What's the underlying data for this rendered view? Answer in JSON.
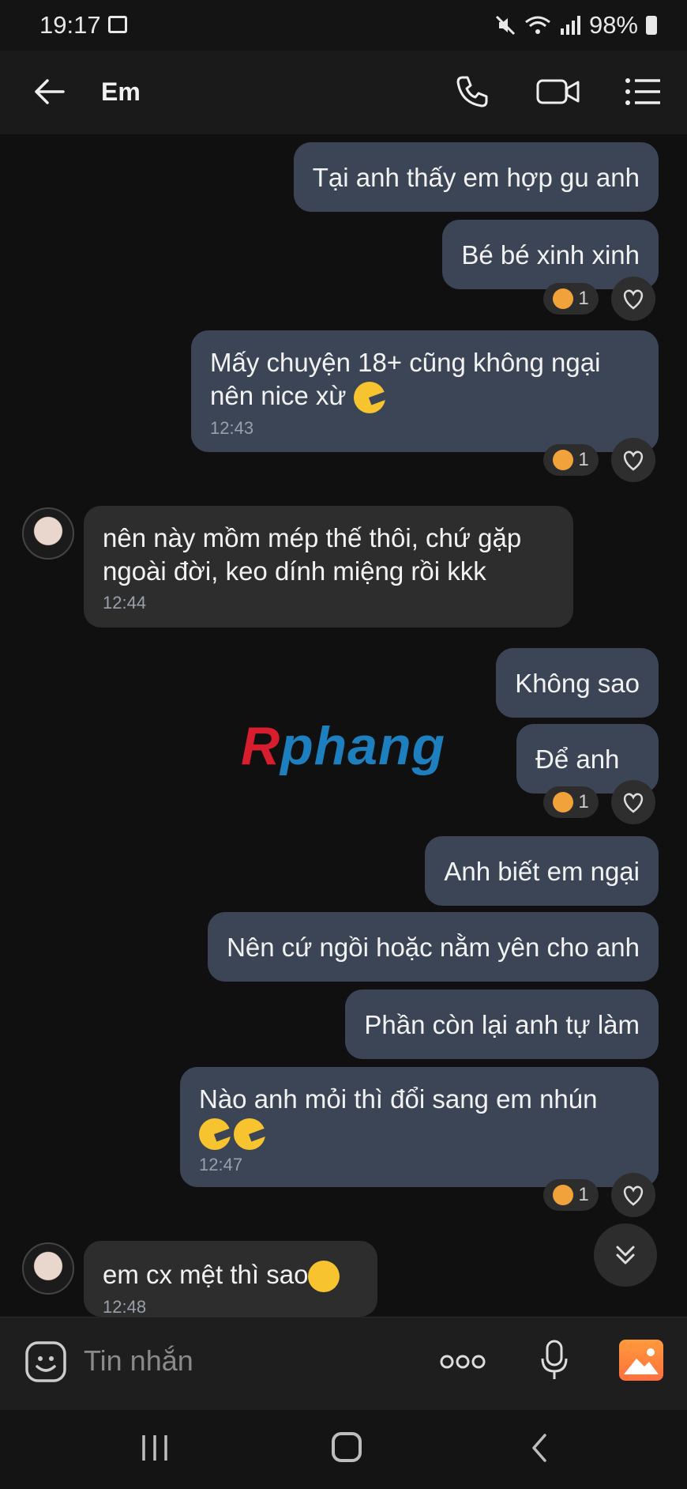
{
  "status_bar": {
    "time": "19:17",
    "battery": "98%"
  },
  "header": {
    "title": "Em"
  },
  "messages": [
    {
      "side": "sent",
      "text": "Tại anh thấy em hợp gu anh"
    },
    {
      "side": "sent",
      "text": "Bé bé xinh xinh",
      "reaction_count": "1"
    },
    {
      "side": "sent",
      "text": "Mấy chuyện 18+ cũng không ngại",
      "text2": "nên nice xừ",
      "time": "12:43",
      "reaction_count": "1"
    },
    {
      "side": "received",
      "text": "nên này mồm mép thế thôi, chứ gặp",
      "text2": "ngoài đời, keo dính miệng rồi kkk",
      "time": "12:44"
    },
    {
      "side": "sent",
      "text": "Không sao"
    },
    {
      "side": "sent",
      "text": "Để anh",
      "reaction_count": "1"
    },
    {
      "side": "sent",
      "text": "Anh biết em ngại"
    },
    {
      "side": "sent",
      "text": "Nên cứ ngồi hoặc nằm yên cho anh"
    },
    {
      "side": "sent",
      "text": "Phần còn lại anh tự làm"
    },
    {
      "side": "sent",
      "text": "Nào anh mỏi thì đổi sang em nhún",
      "time": "12:47",
      "reaction_count": "1"
    },
    {
      "side": "received",
      "text": "em cx mệt thì sao",
      "time": "12:48"
    }
  ],
  "watermark": {
    "first": "R",
    "rest": "phang"
  },
  "input": {
    "placeholder": "Tin nhắn"
  },
  "colors": {
    "sent_bubble": "#3b4556",
    "received_bubble": "#2d2d2d",
    "background": "#101010"
  }
}
